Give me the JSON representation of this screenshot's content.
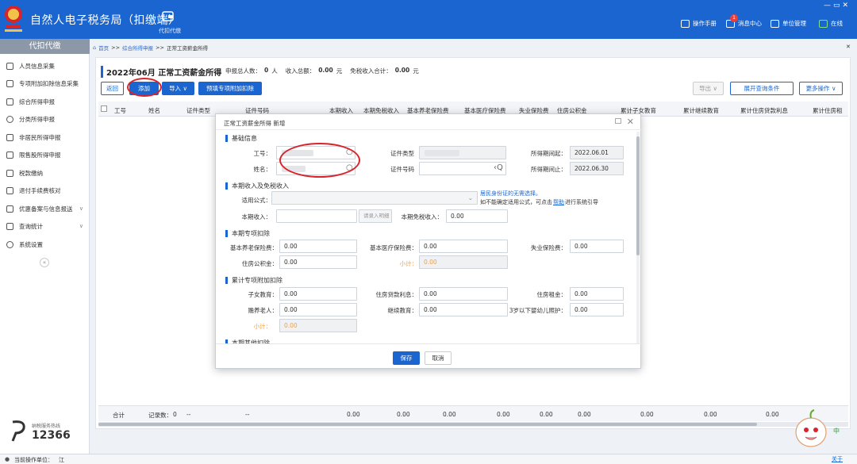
{
  "app": {
    "title": "自然人电子税务局（扣缴端）",
    "top_nav_label": "代扣代缴"
  },
  "top_right": {
    "manual": "操作手册",
    "messages": "消息中心",
    "message_count": "1",
    "unit_mgmt": "单位管理",
    "online": "在线"
  },
  "sidebar": {
    "header": "代扣代缴",
    "items": [
      {
        "label": "人员信息采集"
      },
      {
        "label": "专项附加扣除信息采集"
      },
      {
        "label": "综合所得申报"
      },
      {
        "label": "分类所得申报"
      },
      {
        "label": "非居民所得申报"
      },
      {
        "label": "限售股所得申报"
      },
      {
        "label": "税款缴纳"
      },
      {
        "label": "退付手续费核对"
      },
      {
        "label": "优惠备案与信息报送"
      },
      {
        "label": "查询统计"
      },
      {
        "label": "系统设置"
      }
    ],
    "hotline_label": "纳税服务热线",
    "hotline_number": "12366"
  },
  "breadcrumb": {
    "home": "首页",
    "sep": ">>",
    "level2": "综合所得申报",
    "current": "正常工资薪金所得"
  },
  "panel": {
    "period_title": "2022年06月 正常工资薪金所得",
    "summary": {
      "people_label": "申报总人数：",
      "people": "0",
      "people_unit": "人",
      "income_label": "收入总额：",
      "income": "0.00",
      "yuan": "元",
      "exempt_label": "免税收入合计：",
      "exempt": "0.00",
      "yuan2": "元"
    },
    "buttons": {
      "back": "返回",
      "add": "添加",
      "import": "导入 ∨",
      "prefill": "预填专项附加扣除",
      "export": "导出 ∨",
      "expand": "展开查询条件",
      "more": "更多操作 ∨"
    },
    "columns": [
      "工号",
      "姓名",
      "证件类型",
      "证件号码",
      "本期收入",
      "本期免税收入",
      "基本养老保险费",
      "基本医疗保险费",
      "失业保险费",
      "住房公积金",
      "累计子女教育",
      "累计继续教育",
      "累计住房贷款利息",
      "累计住房租"
    ],
    "footer": {
      "total": "合计",
      "records_label": "记录数：",
      "records": "0",
      "dash": "--",
      "zero": "0.00"
    }
  },
  "dialog": {
    "title": "正常工资薪金所得 新增",
    "sections": {
      "basic": "基础信息",
      "income": "本期收入及免税收入",
      "special": "本期专项扣除",
      "cumulative": "累计专项附加扣除",
      "other": "本期其他扣除"
    },
    "fields": {
      "emp_no": "工号：",
      "name": "姓名：",
      "id_type": "证件类型",
      "id_no": "证件号码",
      "period_start_label": "所得期间起：",
      "period_start": "2022.06.01",
      "period_end_label": "所得期间止：",
      "period_end": "2022.06.30",
      "formula_label": "适用公式：",
      "formula_hint1": "居民身份证的无需选择。",
      "formula_hint2a": "如不能确定适用公式，可点击",
      "formula_hint2b": "帮助",
      "formula_hint2c": "进行系统引导",
      "income_label": "本期收入：",
      "income_btn": "请录入明细",
      "exempt_label": "本期免税收入：",
      "exempt": "0.00",
      "pension_label": "基本养老保险费：",
      "pension": "0.00",
      "medical_label": "基本医疗保险费：",
      "medical": "0.00",
      "unemp_label": "失业保险费：",
      "unemp": "0.00",
      "housing_fund_label": "住房公积金：",
      "housing_fund": "0.00",
      "subtotal_label": "小计：",
      "subtotal": "0.00",
      "children_label": "子女教育：",
      "children": "0.00",
      "loan_label": "住房贷款利息：",
      "loan": "0.00",
      "rent_label": "住房租金：",
      "rent": "0.00",
      "elderly_label": "赡养老人：",
      "elderly": "0.00",
      "cont_edu_label": "继续教育：",
      "cont_edu": "0.00",
      "infant_label": "3岁以下婴幼儿照护：",
      "infant": "0.00",
      "subtotal2_label": "小计：",
      "subtotal2": "0.00"
    },
    "buttons": {
      "save": "保存",
      "cancel": "取消"
    }
  },
  "bottom": {
    "current_unit_label": "当前操作单位：",
    "current_unit": "江"
  },
  "float": {
    "zh": "中",
    "settings": "关于"
  },
  "colors": {
    "brand_blue": "#1b65d1",
    "highlight_red": "#d9232a",
    "subtotal_orange": "#f0a048"
  }
}
